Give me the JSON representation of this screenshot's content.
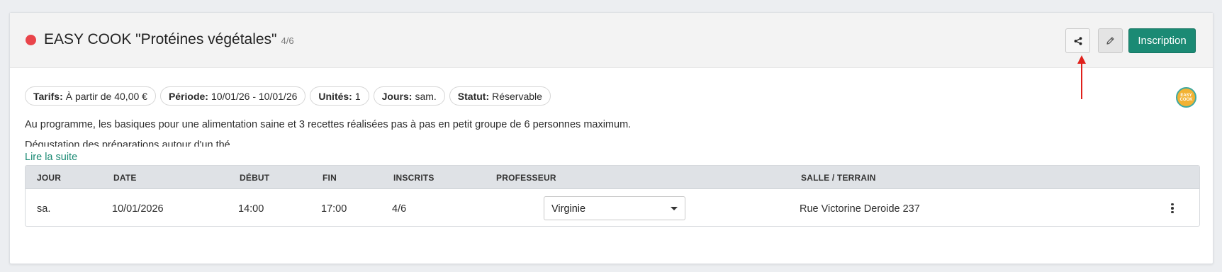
{
  "course": {
    "title": "EASY COOK \"Protéines végétales\"",
    "count": "4/6",
    "status_color": "#e9444a"
  },
  "actions": {
    "share_icon": "share-icon",
    "edit_icon": "pencil-icon",
    "inscription_label": "Inscription"
  },
  "tags": [
    {
      "label": "Tarifs:",
      "value": "À partir de 40,00 €"
    },
    {
      "label": "Période:",
      "value": "10/01/26 - 10/01/26"
    },
    {
      "label": "Unités:",
      "value": "1"
    },
    {
      "label": "Jours:",
      "value": "sam."
    },
    {
      "label": "Statut:",
      "value": "Réservable"
    }
  ],
  "logo": {
    "text": "EASY COOK"
  },
  "description": {
    "line1": "Au programme, les basiques pour une alimentation saine et 3 recettes réalisées pas à pas en petit groupe de 6 personnes maximum.",
    "line2": "Dégustation des préparations autour d'un thé.",
    "read_more": "Lire la suite"
  },
  "table": {
    "headers": [
      "JOUR",
      "DATE",
      "DÉBUT",
      "FIN",
      "INSCRITS",
      "PROFESSEUR",
      "SALLE / TERRAIN"
    ],
    "rows": [
      {
        "jour": "sa.",
        "date": "10/01/2026",
        "debut": "14:00",
        "fin": "17:00",
        "inscrits": "4/6",
        "professeur": "Virginie",
        "salle": "Rue Victorine Deroide 237"
      }
    ]
  },
  "colors": {
    "primary": "#1b8a74",
    "status_red": "#e9444a",
    "annotation_arrow": "#e0201b"
  }
}
